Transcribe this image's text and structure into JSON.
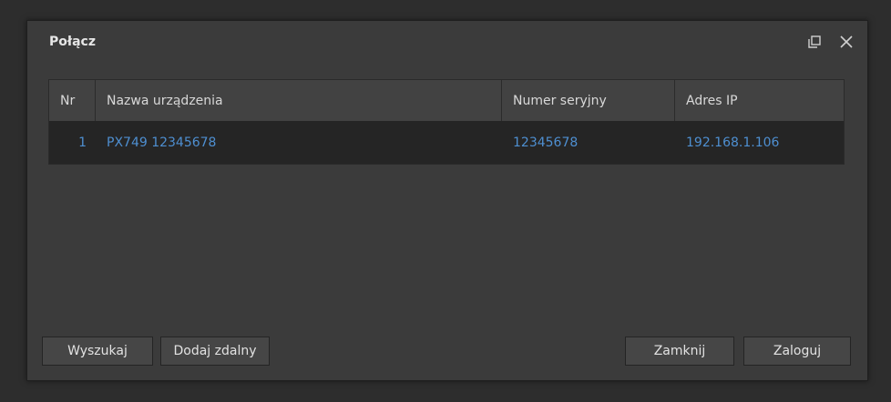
{
  "dialog": {
    "title": "Połącz"
  },
  "colors": {
    "link_blue": "#4e8fd1",
    "dialog_bg": "#3b3b3b",
    "header_bg": "#424242",
    "row_bg": "#252525"
  },
  "icons": {
    "restore": "restore-window-icon",
    "close": "close-icon"
  },
  "table": {
    "headers": {
      "nr": "Nr",
      "name": "Nazwa urządzenia",
      "serial": "Numer seryjny",
      "ip": "Adres IP"
    },
    "rows": [
      {
        "nr": "1",
        "name": "PX749 12345678",
        "serial": "12345678",
        "ip": "192.168.1.106"
      }
    ]
  },
  "buttons": {
    "search": "Wyszukaj",
    "add_remote": "Dodaj zdalny",
    "close": "Zamknij",
    "login": "Zaloguj"
  }
}
